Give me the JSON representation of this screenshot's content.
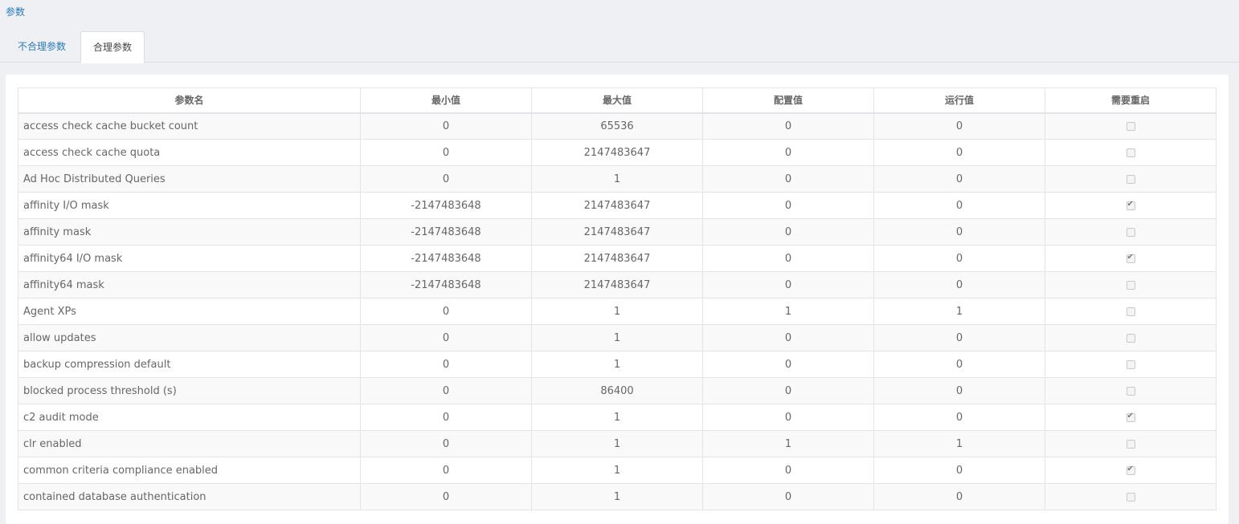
{
  "breadcrumb": "参数",
  "tabs": [
    {
      "label": "不合理参数",
      "active": false
    },
    {
      "label": "合理参数",
      "active": true
    }
  ],
  "table": {
    "headers": [
      "参数名",
      "最小值",
      "最大值",
      "配置值",
      "运行值",
      "需要重启"
    ],
    "rows": [
      {
        "name": "access check cache bucket count",
        "min": "0",
        "max": "65536",
        "config": "0",
        "run": "0",
        "restart": false
      },
      {
        "name": "access check cache quota",
        "min": "0",
        "max": "2147483647",
        "config": "0",
        "run": "0",
        "restart": false
      },
      {
        "name": "Ad Hoc Distributed Queries",
        "min": "0",
        "max": "1",
        "config": "0",
        "run": "0",
        "restart": false
      },
      {
        "name": "affinity I/O mask",
        "min": "-2147483648",
        "max": "2147483647",
        "config": "0",
        "run": "0",
        "restart": true
      },
      {
        "name": "affinity mask",
        "min": "-2147483648",
        "max": "2147483647",
        "config": "0",
        "run": "0",
        "restart": false
      },
      {
        "name": "affinity64 I/O mask",
        "min": "-2147483648",
        "max": "2147483647",
        "config": "0",
        "run": "0",
        "restart": true
      },
      {
        "name": "affinity64 mask",
        "min": "-2147483648",
        "max": "2147483647",
        "config": "0",
        "run": "0",
        "restart": false
      },
      {
        "name": "Agent XPs",
        "min": "0",
        "max": "1",
        "config": "1",
        "run": "1",
        "restart": false
      },
      {
        "name": "allow updates",
        "min": "0",
        "max": "1",
        "config": "0",
        "run": "0",
        "restart": false
      },
      {
        "name": "backup compression default",
        "min": "0",
        "max": "1",
        "config": "0",
        "run": "0",
        "restart": false
      },
      {
        "name": "blocked process threshold (s)",
        "min": "0",
        "max": "86400",
        "config": "0",
        "run": "0",
        "restart": false
      },
      {
        "name": "c2 audit mode",
        "min": "0",
        "max": "1",
        "config": "0",
        "run": "0",
        "restart": true
      },
      {
        "name": "clr enabled",
        "min": "0",
        "max": "1",
        "config": "1",
        "run": "1",
        "restart": false
      },
      {
        "name": "common criteria compliance enabled",
        "min": "0",
        "max": "1",
        "config": "0",
        "run": "0",
        "restart": true
      },
      {
        "name": "contained database authentication",
        "min": "0",
        "max": "1",
        "config": "0",
        "run": "0",
        "restart": false
      }
    ]
  }
}
